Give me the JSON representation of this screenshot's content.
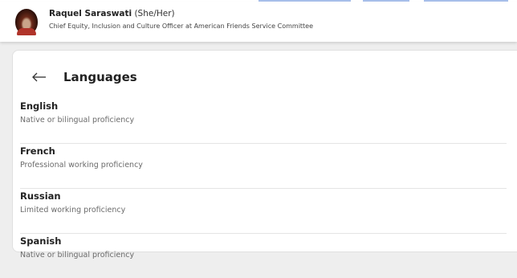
{
  "profile": {
    "name": "Raquel Saraswati",
    "pronouns": "(She/Her)",
    "headline": "Chief Equity, Inclusion and Culture Officer at American Friends Service Committee"
  },
  "section": {
    "back_icon": "arrow-left-icon",
    "title": "Languages"
  },
  "languages": [
    {
      "name": "English",
      "proficiency": "Native or bilingual proficiency"
    },
    {
      "name": "French",
      "proficiency": "Professional working proficiency"
    },
    {
      "name": "Russian",
      "proficiency": "Limited working proficiency"
    },
    {
      "name": "Spanish",
      "proficiency": "Native or bilingual proficiency"
    }
  ],
  "colors": {
    "link_fragment": "#5f8bd8",
    "card_background": "#ffffff",
    "page_background": "#eeeeee"
  }
}
